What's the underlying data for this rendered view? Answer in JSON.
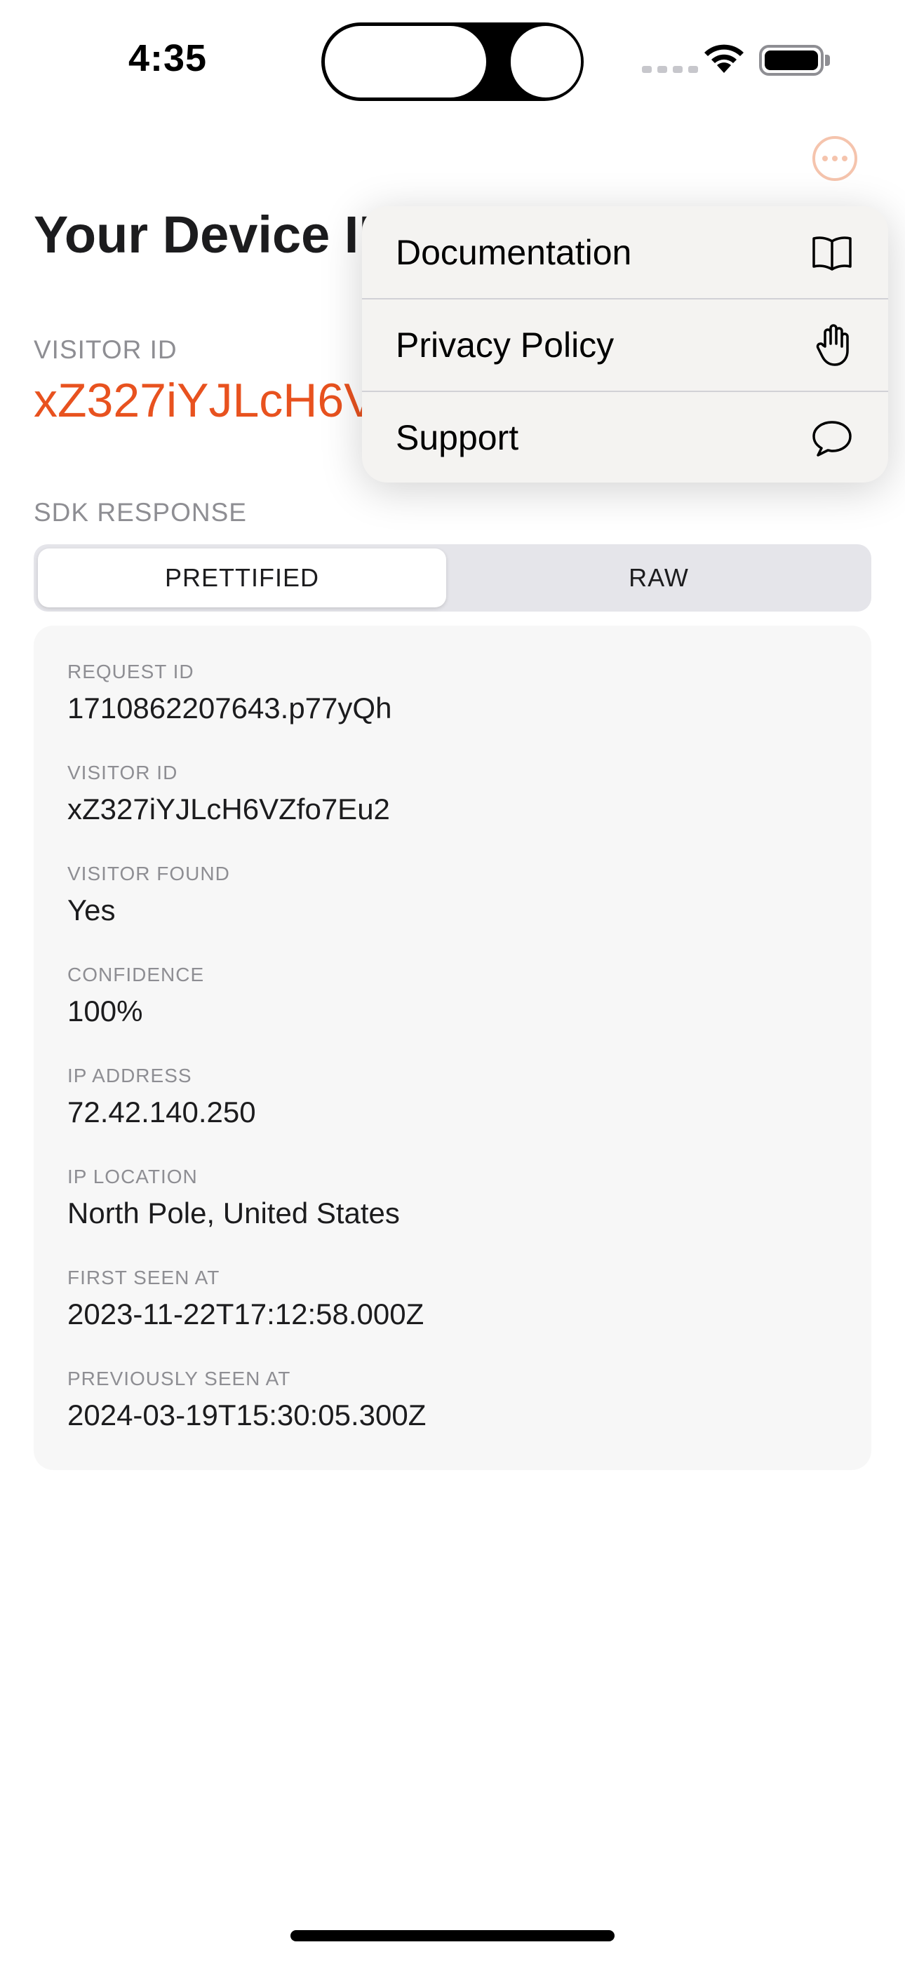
{
  "status_bar": {
    "time": "4:35"
  },
  "header": {
    "title": "Your Device ID",
    "more_icon": "ellipsis-circle-icon"
  },
  "visitor": {
    "caption": "VISITOR ID",
    "value": "xZ327iYJLcH6VZfo7Eu2"
  },
  "sdk_response": {
    "caption": "SDK RESPONSE",
    "tabs": [
      {
        "label": "PRETTIFIED",
        "selected": true
      },
      {
        "label": "RAW",
        "selected": false
      }
    ],
    "fields": [
      {
        "label": "REQUEST ID",
        "value": "1710862207643.p77yQh"
      },
      {
        "label": "VISITOR ID",
        "value": "xZ327iYJLcH6VZfo7Eu2"
      },
      {
        "label": "VISITOR FOUND",
        "value": "Yes"
      },
      {
        "label": "CONFIDENCE",
        "value": "100%"
      },
      {
        "label": "IP ADDRESS",
        "value": "72.42.140.250"
      },
      {
        "label": "IP LOCATION",
        "value": "North Pole, United States"
      },
      {
        "label": "FIRST SEEN AT",
        "value": "2023-11-22T17:12:58.000Z"
      },
      {
        "label": "PREVIOUSLY SEEN AT",
        "value": "2024-03-19T15:30:05.300Z"
      }
    ]
  },
  "menu": {
    "items": [
      {
        "label": "Documentation",
        "icon": "book-icon"
      },
      {
        "label": "Privacy Policy",
        "icon": "hand-raised-icon"
      },
      {
        "label": "Support",
        "icon": "speech-bubble-icon"
      }
    ]
  },
  "colors": {
    "accent": "#e8521f",
    "accent_light": "#f5c4ad",
    "secondary_text": "#8e8e93",
    "card_background": "#f7f7f7",
    "menu_background": "#f4f3f1"
  }
}
